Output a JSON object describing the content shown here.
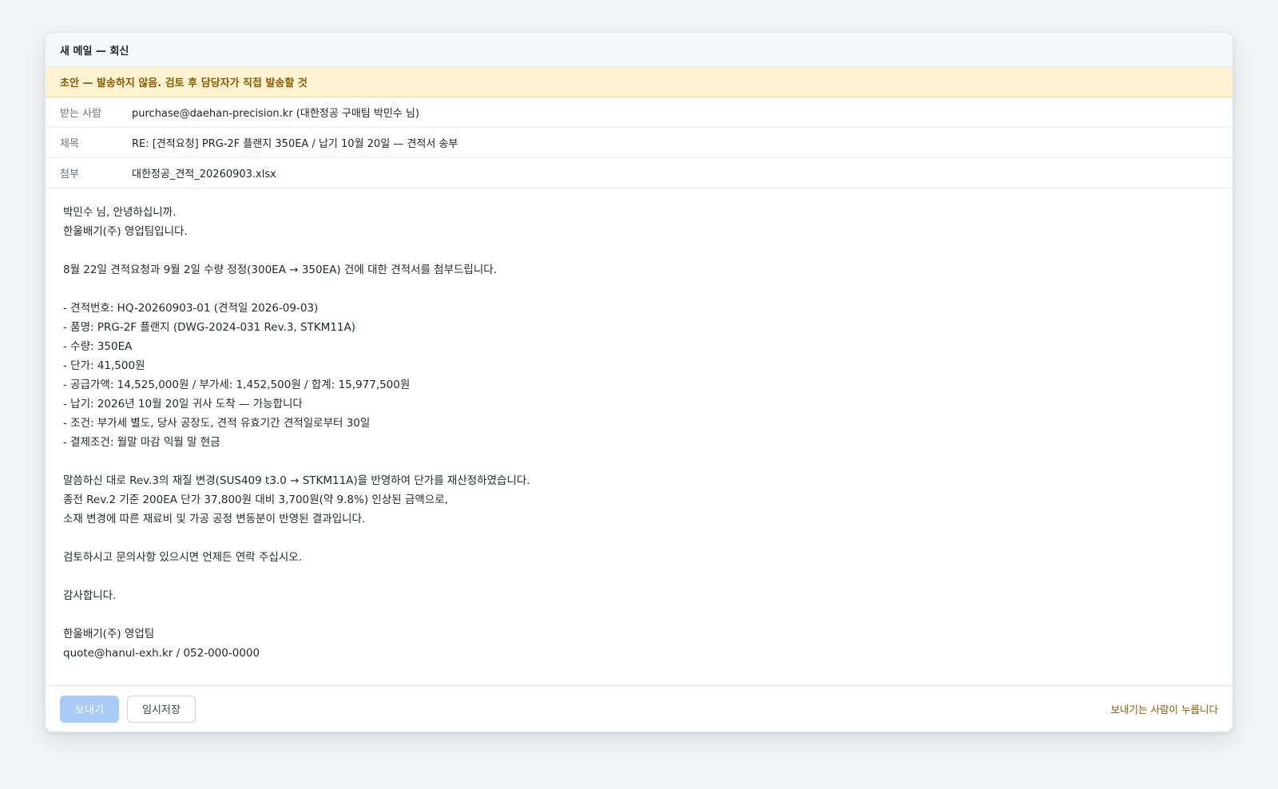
{
  "window": {
    "title": "새 메일 — 회신"
  },
  "banner": {
    "text": "초안 — 발송하지 않음. 검토 후 담당자가 직접 발송할 것"
  },
  "fields": {
    "to": {
      "label": "받는 사람",
      "value": "purchase@daehan-precision.kr (대한정공 구매팀 박민수 님)"
    },
    "subject": {
      "label": "제목",
      "value": "RE: [견적요청] PRG-2F 플랜지 350EA / 납기 10월 20일 — 견적서 송부"
    },
    "attachment": {
      "label": "첨부",
      "value": "대한정공_견적_20260903.xlsx"
    }
  },
  "body": {
    "lines": [
      "박민수 님, 안녕하십니까.",
      "한울배기(주) 영업팀입니다.",
      "",
      "8월 22일 견적요청과 9월 2일 수량 정정(300EA → 350EA) 건에 대한 견적서를 첨부드립니다.",
      "",
      "- 견적번호: HQ-20260903-01 (견적일 2026-09-03)",
      "- 품명: PRG-2F 플랜지 (DWG-2024-031 Rev.3, STKM11A)",
      "- 수량: 350EA",
      "- 단가: 41,500원",
      "- 공급가액: 14,525,000원 / 부가세: 1,452,500원 / 합계: 15,977,500원",
      "- 납기: 2026년 10월 20일 귀사 도착 — 가능합니다",
      "- 조건: 부가세 별도, 당사 공장도, 견적 유효기간 견적일로부터 30일",
      "- 결제조건: 월말 마감 익월 말 현금",
      "",
      "말씀하신 대로 Rev.3의 재질 변경(SUS409 t3.0 → STKM11A)을 반영하여 단가를 재산정하였습니다.",
      "종전 Rev.2 기준 200EA 단가 37,800원 대비 3,700원(약 9.8%) 인상된 금액으로,",
      "소재 변경에 따른 재료비 및 가공 공정 변동분이 반영된 결과입니다.",
      "",
      "검토하시고 문의사항 있으시면 언제든 연락 주십시오.",
      "",
      "감사합니다.",
      "",
      "한울배기(주) 영업팀",
      "quote@hanul-exh.kr / 052-000-0000"
    ]
  },
  "footer": {
    "send_label": "보내기",
    "draft_label": "임시저장",
    "note": "보내기는 사람이 누릅니다"
  },
  "colors": {
    "banner_bg": "#fdf3d2",
    "banner_text": "#8a5a00",
    "send_disabled": "#a9cbf5"
  }
}
